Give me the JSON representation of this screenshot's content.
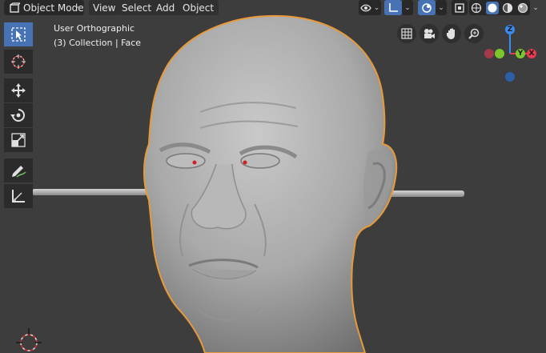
{
  "header": {
    "mode_label": "Object Mode",
    "menus": [
      "View",
      "Select",
      "Add",
      "Object"
    ]
  },
  "viewport": {
    "view_name": "User Orthographic",
    "collection_info": "(3) Collection | Face"
  },
  "toolbar": {
    "tools": [
      "select-box",
      "cursor",
      "move",
      "rotate",
      "scale",
      "annotate",
      "measure"
    ],
    "active_tool": "select-box"
  },
  "gizmo": {
    "z_label": "Z",
    "y_label": "Y",
    "x_label": "X"
  },
  "colors": {
    "viewport_bg": "#3d3d3d",
    "selection_outline": "#e89a3a",
    "active_blue": "#4772b3",
    "axis_x": "#e63b50",
    "axis_y": "#7cc72b",
    "axis_z": "#3a8cf0"
  }
}
